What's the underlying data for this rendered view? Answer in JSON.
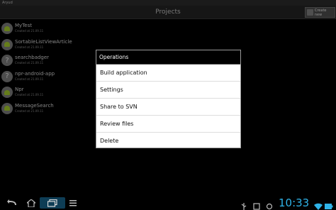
{
  "status": {
    "app_name": "Aryud"
  },
  "titlebar": {
    "title": "Projects",
    "create_label": "Create new"
  },
  "projects": [
    {
      "name": "MyTest",
      "date": "Created at 21.09.11",
      "icon": "android-icon"
    },
    {
      "name": "SortableListViewArticle",
      "date": "Created at 21.09.11",
      "icon": "android-icon"
    },
    {
      "name": "searchbadger",
      "date": "Created at 21.09.11",
      "icon": "unknown-project-icon"
    },
    {
      "name": "npr-android-app",
      "date": "Created at 21.09.11",
      "icon": "unknown-project-icon"
    },
    {
      "name": "Npr",
      "date": "Created at 21.09.11",
      "icon": "android-icon"
    },
    {
      "name": "MessageSearch",
      "date": "Created at 21.09.11",
      "icon": "android-icon"
    }
  ],
  "dialog": {
    "title": "Operations",
    "options": [
      "Build application",
      "Settings",
      "Share to SVN",
      "Review files",
      "Delete"
    ]
  },
  "navbar": {
    "clock": "10:33"
  },
  "colors": {
    "clock": "#2fb3e8",
    "android_green": "#9bc02a"
  }
}
